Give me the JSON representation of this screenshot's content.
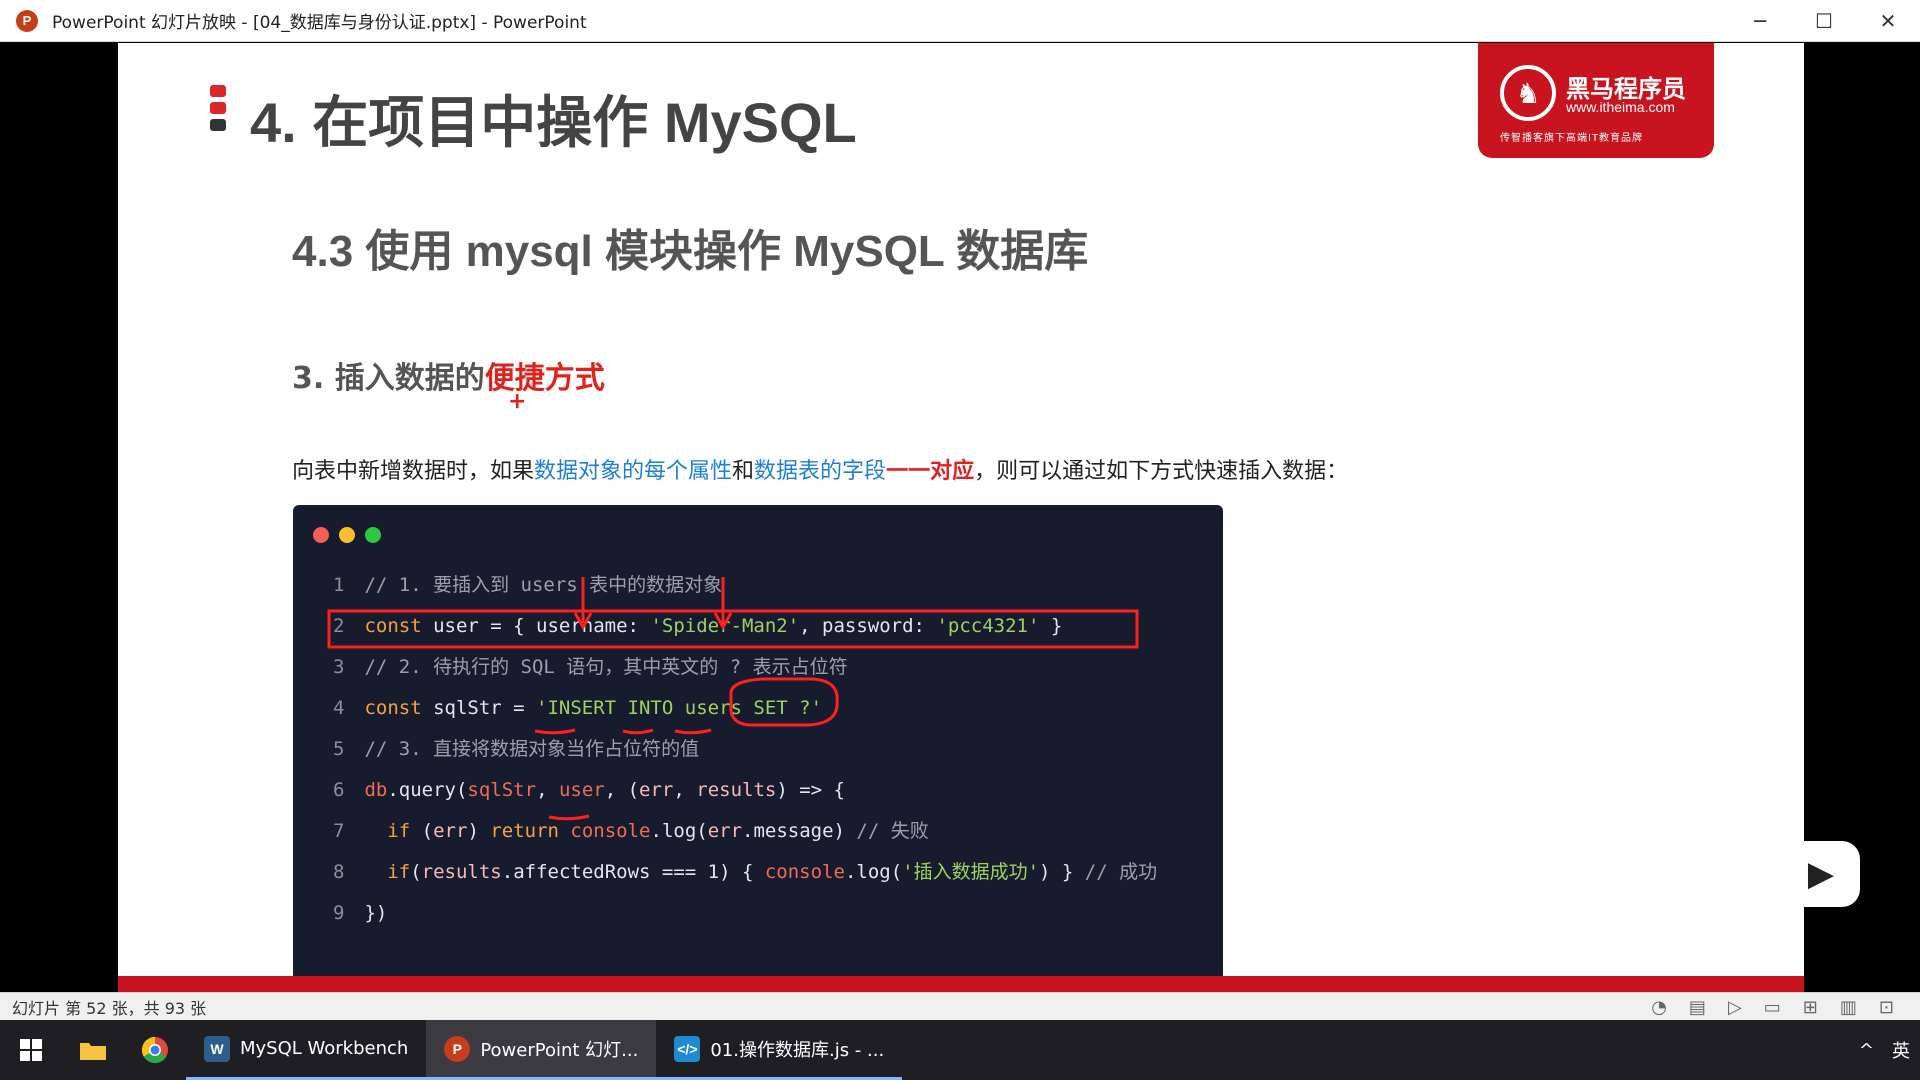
{
  "window": {
    "title": "PowerPoint 幻灯片放映 - [04_数据库与身份认证.pptx] - PowerPoint",
    "controls": {
      "minimize": "─",
      "maximize": "☐",
      "close": "✕"
    }
  },
  "slide": {
    "title": "4. 在项目中操作 MySQL",
    "logo": {
      "name": "黑马程序员",
      "url": "www.itheima.com",
      "slogan": "传智播客旗下高端IT教育品牌"
    },
    "section_title": "4.3 使用 mysql 模块操作 MySQL 数据库",
    "point_title": {
      "prefix": "3. 插入数据的",
      "highlight": "便捷方式"
    },
    "cursor": "+",
    "description": {
      "p1": "向表中新增数据时，如果",
      "p2": "数据对象的每个属性",
      "p3": "和",
      "p4": "数据表的字段",
      "p5": "一一对应",
      "p6": "，则可以通过如下方式快速插入数据："
    },
    "code": {
      "dot_colors": [
        "#f25f57",
        "#fbbd2e",
        "#2ec840"
      ],
      "l1": {
        "n": "1",
        "comment": "// 1. 要插入到 users 表中的数据对象"
      },
      "l2": {
        "n": "2",
        "kw": "const",
        "a": " user = { username: ",
        "s1": "'Spider-Man2'",
        "b": ", password: ",
        "s2": "'pcc4321'",
        "c": " }"
      },
      "l3": {
        "n": "3",
        "comment": "// 2. 待执行的 SQL 语句，其中英文的 ? 表示占位符"
      },
      "l4": {
        "n": "4",
        "kw": "const",
        "a": " sqlStr = ",
        "s": "'INSERT INTO users SET ?'"
      },
      "l5": {
        "n": "5",
        "comment": "// 3. 直接将数据对象当作占位符的值"
      },
      "l6": {
        "n": "6",
        "db": "db",
        "a": ".query(",
        "v1": "sqlStr",
        "b": ", ",
        "v2": "user",
        "c": ", (",
        "v3": "err",
        "d": ", ",
        "v4": "results",
        "e": ") => {"
      },
      "l7": {
        "n": "7",
        "kw1": "  if",
        "a": " (",
        "v1": "err",
        "b": ") ",
        "kw2": "return",
        "c": " ",
        "v2": "console",
        "d": ".log(",
        "v3": "err",
        "e": ".message) ",
        "comment": "// 失败"
      },
      "l8": {
        "n": "8",
        "kw": "  if",
        "a": "(",
        "v1": "results",
        "b": ".affectedRows === 1) { ",
        "v2": "console",
        "c": ".log(",
        "s": "'插入数据成功'",
        "d": ") } ",
        "comment": "// 成功"
      },
      "l9": {
        "n": "9",
        "a": "})"
      }
    }
  },
  "status": {
    "text": "幻灯片 第 52 张，共 93 张"
  },
  "taskbar": {
    "start_icon": "windows-icon",
    "apps": [
      {
        "label": "MySQL Workbench",
        "icon": "mysql-workbench-icon"
      },
      {
        "label": "PowerPoint 幻灯...",
        "icon": "powerpoint-icon"
      },
      {
        "label": "01.操作数据库.js - ...",
        "icon": "vscode-icon"
      }
    ],
    "tray": {
      "chevron": "^",
      "ime": "英"
    }
  },
  "colors": {
    "accent_red": "#c8141e",
    "highlight_red": "#e0211c",
    "highlight_blue": "#1c7fd6",
    "code_bg": "#161b2e"
  }
}
